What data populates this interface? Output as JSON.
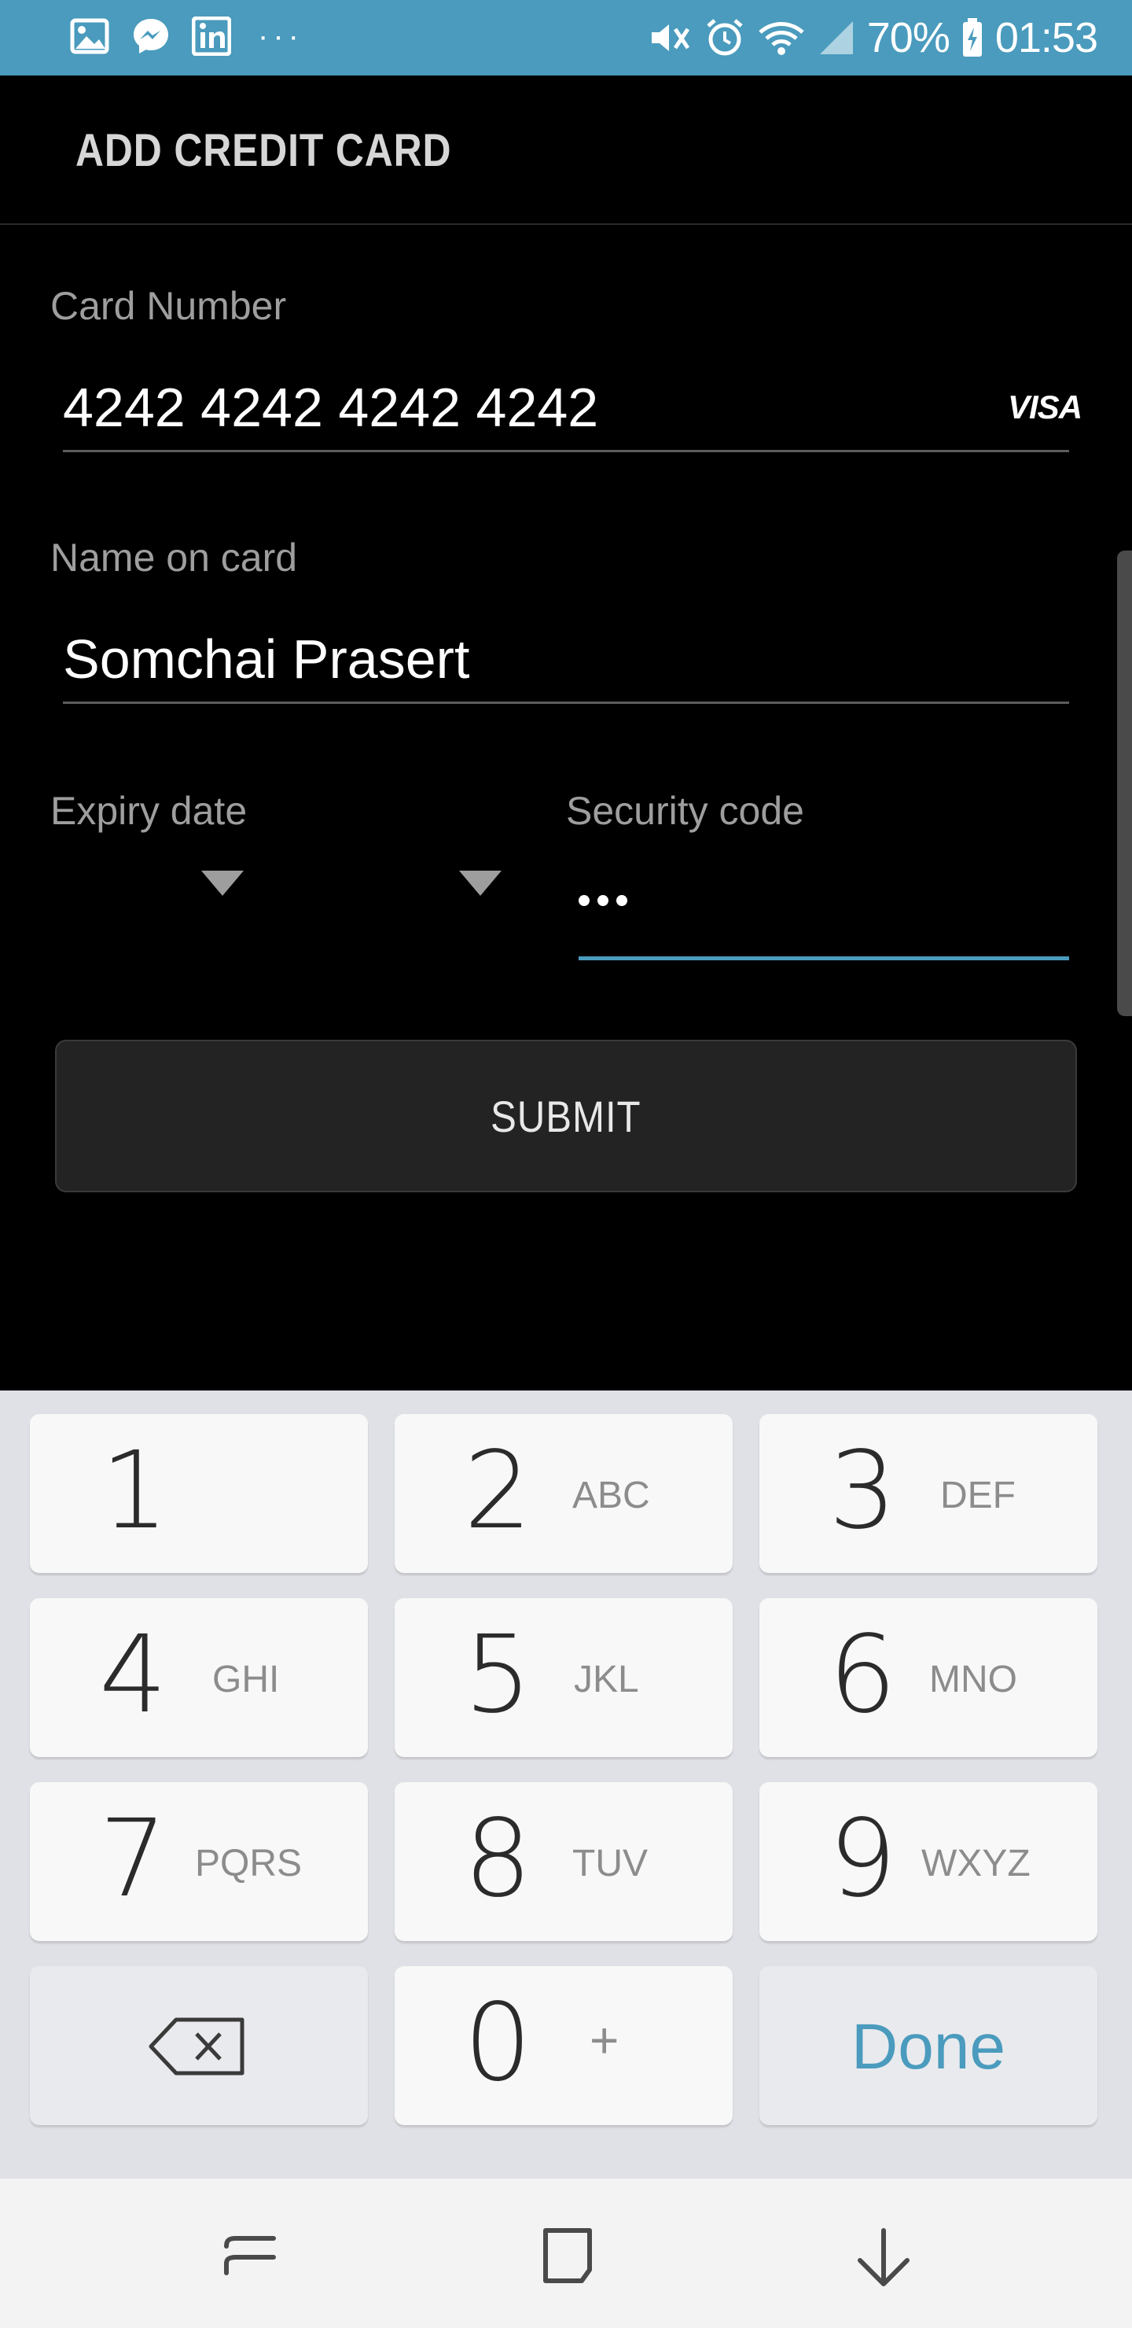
{
  "status_bar": {
    "battery": "70%",
    "time": "01:53",
    "more": "···",
    "left_icons": [
      "gallery-icon",
      "messenger-icon",
      "linkedin-icon"
    ],
    "right_icons": [
      "mute-icon",
      "alarm-icon",
      "wifi-icon",
      "signal-icon",
      "battery-icon"
    ]
  },
  "app_bar": {
    "title": "ADD CREDIT CARD"
  },
  "form": {
    "card_number": {
      "label": "Card Number",
      "value": "4242 4242 4242 4242",
      "brand": "VISA"
    },
    "name": {
      "label": "Name on card",
      "value": "Somchai Prasert"
    },
    "expiry": {
      "label": "Expiry date"
    },
    "security": {
      "label": "Security code"
    },
    "submit_label": "SUBMIT"
  },
  "keyboard": {
    "k1": {
      "num": "1",
      "sub": ""
    },
    "k2": {
      "num": "2",
      "sub": "ABC"
    },
    "k3": {
      "num": "3",
      "sub": "DEF"
    },
    "k4": {
      "num": "4",
      "sub": "GHI"
    },
    "k5": {
      "num": "5",
      "sub": "JKL"
    },
    "k6": {
      "num": "6",
      "sub": "MNO"
    },
    "k7": {
      "num": "7",
      "sub": "PQRS"
    },
    "k8": {
      "num": "8",
      "sub": "TUV"
    },
    "k9": {
      "num": "9",
      "sub": "WXYZ"
    },
    "k0": {
      "num": "0",
      "sub": "+"
    },
    "done": "Done"
  },
  "colors": {
    "accent": "#4a9bbd",
    "status_bar": "#4a9bbd",
    "background": "#000000"
  }
}
